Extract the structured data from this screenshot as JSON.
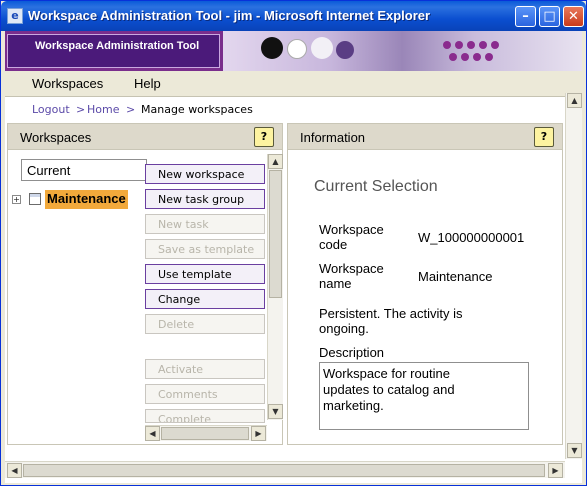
{
  "window": {
    "title": "Workspace Administration Tool - jim - Microsoft Internet Explorer"
  },
  "banner": {
    "title": "Workspace Administration Tool"
  },
  "menu": {
    "items": [
      "Workspaces",
      "Help"
    ]
  },
  "breadcrumb": {
    "logout": "Logout",
    "sep": ">",
    "home": "Home",
    "current": "Manage workspaces"
  },
  "workspaces_panel": {
    "title": "Workspaces",
    "help": "?",
    "filter_value": "Current",
    "tree": [
      {
        "label": "Maintenance",
        "selected": true
      }
    ],
    "buttons": [
      {
        "label": "New workspace",
        "enabled": true
      },
      {
        "label": "New task group",
        "enabled": true
      },
      {
        "label": "New task",
        "enabled": false
      },
      {
        "label": "Save as template",
        "enabled": false
      },
      {
        "label": "Use template",
        "enabled": true
      },
      {
        "label": "Change",
        "enabled": true
      },
      {
        "label": "Delete",
        "enabled": false
      },
      {
        "label": "Activate",
        "enabled": false
      },
      {
        "label": "Comments",
        "enabled": false
      },
      {
        "label": "Complete",
        "enabled": false
      }
    ]
  },
  "info_panel": {
    "title": "Information",
    "help": "?",
    "heading": "Current Selection",
    "code_label_1": "Workspace",
    "code_label_2": "code",
    "code_value": "W_100000000001",
    "name_label_1": "Workspace",
    "name_label_2": "name",
    "name_value": "Maintenance",
    "status_line_1": "Persistent. The activity is",
    "status_line_2": "ongoing.",
    "description_label": "Description",
    "description_line_1": "Workspace for routine",
    "description_line_2": "updates to catalog and",
    "description_line_3": "marketing."
  },
  "colors": {
    "accent": "#7a2e8c",
    "selected": "#f2a93b",
    "button_border": "#6a3fa0"
  }
}
